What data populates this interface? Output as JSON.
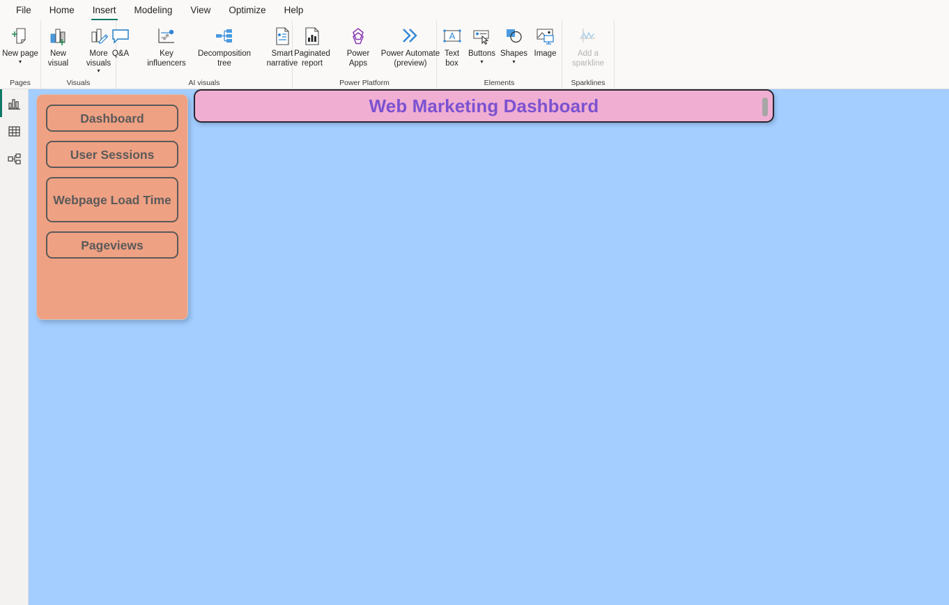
{
  "app": {
    "name": "Power BI Desktop"
  },
  "ribbon": {
    "tabs": [
      {
        "label": "File",
        "active": false
      },
      {
        "label": "Home",
        "active": false
      },
      {
        "label": "Insert",
        "active": true
      },
      {
        "label": "Modeling",
        "active": false
      },
      {
        "label": "View",
        "active": false
      },
      {
        "label": "Optimize",
        "active": false
      },
      {
        "label": "Help",
        "active": false
      }
    ],
    "active_tab": "Insert",
    "accent_color": "#117865",
    "groups": [
      {
        "label": "Pages",
        "items": [
          {
            "label": "New page",
            "icon": "new-page-icon",
            "caret": true,
            "disabled": false
          }
        ]
      },
      {
        "label": "Visuals",
        "items": [
          {
            "label": "New visual",
            "icon": "new-visual-icon",
            "caret": false,
            "disabled": false
          },
          {
            "label": "More visuals",
            "icon": "more-visuals-icon",
            "caret": true,
            "disabled": false
          }
        ]
      },
      {
        "label": "AI visuals",
        "items": [
          {
            "label": "Q&A",
            "icon": "qanda-icon",
            "caret": false,
            "disabled": false
          },
          {
            "label": "Key influencers",
            "icon": "key-influencers-icon",
            "caret": false,
            "disabled": false
          },
          {
            "label": "Decomposition tree",
            "icon": "decomposition-tree-icon",
            "caret": false,
            "disabled": false
          },
          {
            "label": "Smart narrative",
            "icon": "smart-narrative-icon",
            "caret": false,
            "disabled": false
          }
        ]
      },
      {
        "label": "Power Platform",
        "items": [
          {
            "label": "Paginated report",
            "icon": "paginated-report-icon",
            "caret": false,
            "disabled": false
          },
          {
            "label": "Power Apps",
            "icon": "power-apps-icon",
            "caret": false,
            "disabled": false
          },
          {
            "label": "Power Automate (preview)",
            "icon": "power-automate-icon",
            "caret": false,
            "disabled": false
          }
        ]
      },
      {
        "label": "Elements",
        "items": [
          {
            "label": "Text box",
            "icon": "text-box-icon",
            "caret": false,
            "disabled": false
          },
          {
            "label": "Buttons",
            "icon": "buttons-icon",
            "caret": true,
            "disabled": false
          },
          {
            "label": "Shapes",
            "icon": "shapes-icon",
            "caret": true,
            "disabled": false
          },
          {
            "label": "Image",
            "icon": "image-icon",
            "caret": false,
            "disabled": false
          }
        ]
      },
      {
        "label": "Sparklines",
        "items": [
          {
            "label": "Add a sparkline",
            "icon": "sparkline-icon",
            "caret": false,
            "disabled": true
          }
        ]
      }
    ]
  },
  "view_bar": {
    "items": [
      {
        "name": "report-view",
        "icon": "bar-chart-icon",
        "active": true
      },
      {
        "name": "data-view",
        "icon": "table-grid-icon",
        "active": false
      },
      {
        "name": "model-view",
        "icon": "model-nodes-icon",
        "active": false
      }
    ]
  },
  "canvas": {
    "background_color": "#a3ceff",
    "nav_panel": {
      "background_color": "#efa183",
      "border_color": "#595959",
      "text_color": "#5a5a5a",
      "buttons": [
        {
          "label": "Dashboard"
        },
        {
          "label": "User Sessions"
        },
        {
          "label": "Webpage Load Time"
        },
        {
          "label": "Pageviews"
        }
      ]
    },
    "title_banner": {
      "text": "Web Marketing Dashboard",
      "background_color": "#f0aed2",
      "text_color": "#7b52d0",
      "border_color": "#26262c",
      "has_scrollbar": true
    }
  }
}
